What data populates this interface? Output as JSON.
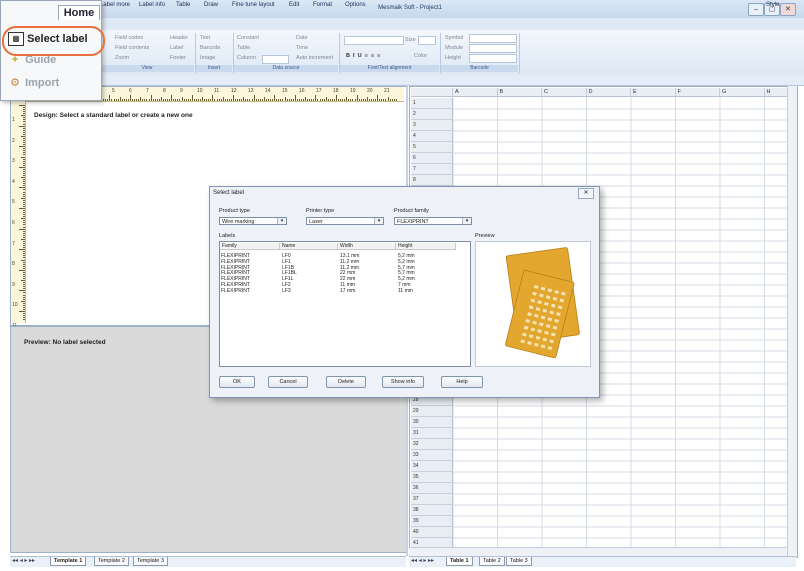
{
  "window": {
    "title": "Mesmaik Soft - Project1",
    "style_label": "Style",
    "buttons": [
      "–",
      "▢",
      "✕"
    ]
  },
  "menu": {
    "items": [
      "Label more",
      "Label info",
      "Table",
      "Draw",
      "Fine tune layout",
      "Edit",
      "Format",
      "Options"
    ]
  },
  "ribbon": {
    "groups": [
      {
        "label": "View",
        "items": [
          "Field codes",
          "Field contents",
          "Zoom"
        ],
        "items2": [
          "Header",
          "Label",
          "Footer"
        ]
      },
      {
        "label": "Insert",
        "items": [
          "Text",
          "Barcode",
          "Image"
        ]
      },
      {
        "label": "Data source",
        "items": [
          "Constant",
          "Table",
          "Column"
        ],
        "items2": [
          "Date",
          "Time",
          "Auto increment"
        ]
      },
      {
        "label": "Font/Text alignment",
        "items": [
          "Size",
          "Color"
        ]
      },
      {
        "label": "Barcode",
        "items": [
          "Symbol",
          "Module",
          "Height"
        ]
      }
    ]
  },
  "home_menu": {
    "tab_label": "Home",
    "items": [
      {
        "label": "Select label",
        "icon": "select-label-icon",
        "enabled": true
      },
      {
        "label": "Guide",
        "icon": "guide-icon",
        "enabled": false
      },
      {
        "label": "Import",
        "icon": "import-icon",
        "enabled": false
      }
    ],
    "highlight_color": "#e8703a"
  },
  "design": {
    "text": "Design: Select a standard label or create a new one",
    "ruler_numbers": [
      "1",
      "2",
      "3",
      "4",
      "5",
      "6",
      "7",
      "8",
      "9",
      "10",
      "11",
      "12",
      "13",
      "14",
      "15",
      "16",
      "17",
      "18",
      "19",
      "20",
      "21"
    ],
    "vruler_numbers": [
      "1",
      "2",
      "3",
      "4",
      "5",
      "6",
      "7",
      "8",
      "9",
      "10",
      "11"
    ]
  },
  "preview": {
    "text": "Preview: No label selected"
  },
  "grid": {
    "columns": [
      "A",
      "B",
      "C",
      "D",
      "E",
      "F",
      "G",
      "H"
    ],
    "rows_top": [
      "1",
      "2",
      "3",
      "4",
      "5",
      "6",
      "7",
      "8"
    ],
    "rows_bottom": [
      "28",
      "29",
      "30",
      "31",
      "32",
      "33",
      "34",
      "35",
      "36",
      "37",
      "38",
      "39",
      "40",
      "41"
    ]
  },
  "left_tabs": [
    "Template 1",
    "Template 2",
    "Template 3"
  ],
  "right_tabs": [
    "Table 1",
    "Table 2",
    "Table 3"
  ],
  "dialog": {
    "title": "Select label",
    "product_type_label": "Product type",
    "product_type_value": "Wire marking",
    "printer_type_label": "Printer type",
    "printer_type_value": "Laser",
    "product_family_label": "Product family",
    "product_family_value": "FLEXIPRINT",
    "labels_heading": "Labels",
    "preview_heading": "Preview",
    "columns": [
      "Family",
      "Name",
      "Width",
      "Height"
    ],
    "rows": [
      [
        "FLEXIPRINT",
        "LF0",
        "13,1 mm",
        "5,2 mm"
      ],
      [
        "FLEXIPRINT",
        "LF1",
        "11,2 mm",
        "5,2 mm"
      ],
      [
        "FLEXIPRINT",
        "LF1B",
        "11,2 mm",
        "5,7 mm"
      ],
      [
        "FLEXIPRINT",
        "LF1BL",
        "22 mm",
        "5,7 mm"
      ],
      [
        "FLEXIPRINT",
        "LF1L",
        "22 mm",
        "5,2 mm"
      ],
      [
        "FLEXIPRINT",
        "LF2",
        "11 mm",
        "7 mm"
      ],
      [
        "FLEXIPRINT",
        "LF3",
        "17 mm",
        "11 mm"
      ]
    ],
    "buttons": [
      "OK",
      "Cancel",
      "Delete",
      "Show info",
      "Help"
    ],
    "sheet_color": "#e3a62e"
  }
}
